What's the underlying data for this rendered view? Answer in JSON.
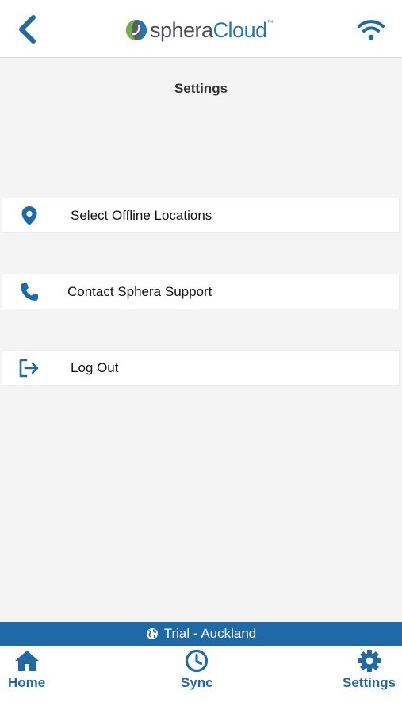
{
  "header": {
    "back_icon": "chevron-left-icon",
    "logo": {
      "word1": "sphera",
      "word2": "Cloud",
      "tm": "™"
    },
    "wifi_icon": "wifi-icon"
  },
  "page": {
    "title": "Settings"
  },
  "menu": [
    {
      "label": "Select Offline Locations",
      "icon": "location-pin-icon"
    },
    {
      "label": "Contact Sphera Support",
      "icon": "phone-icon"
    },
    {
      "label": "Log Out",
      "icon": "logout-icon"
    }
  ],
  "status": {
    "text": "Trial - Auckland",
    "icon": "globe-icon"
  },
  "tabbar": {
    "tabs": [
      {
        "label": "Home",
        "icon": "home-icon"
      },
      {
        "label": "Sync",
        "icon": "clock-icon"
      },
      {
        "label": "Settings",
        "icon": "gear-icon"
      }
    ]
  },
  "colors": {
    "accent": "#1e6aa9",
    "background": "#f4f4f4",
    "logo_green": "#6cb33f",
    "logo_blue": "#1e78b8"
  }
}
